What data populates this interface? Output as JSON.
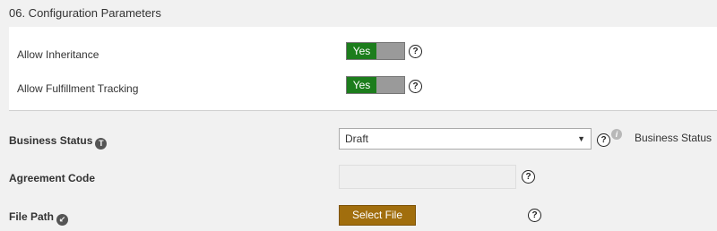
{
  "section": {
    "title": "06. Configuration Parameters"
  },
  "panel": {
    "rows": [
      {
        "label": "Allow Inheritance",
        "toggle_on_label": "Yes",
        "help": "?"
      },
      {
        "label": "Allow Fulfillment Tracking",
        "toggle_on_label": "Yes",
        "help": "?"
      }
    ]
  },
  "fields": {
    "business_status": {
      "label": "Business Status",
      "badge": "T",
      "selected": "Draft",
      "help": "?",
      "info": "i",
      "side_label": "Business Status"
    },
    "agreement_code": {
      "label": "Agreement Code",
      "value": "",
      "help": "?"
    },
    "file_path": {
      "label": "File Path",
      "badge": "↙",
      "button_label": "Select File",
      "help": "?"
    }
  },
  "colors": {
    "toggle_on": "#1c7d1c",
    "toggle_off": "#9a9a9a",
    "select_file_button": "#a16e0d"
  }
}
